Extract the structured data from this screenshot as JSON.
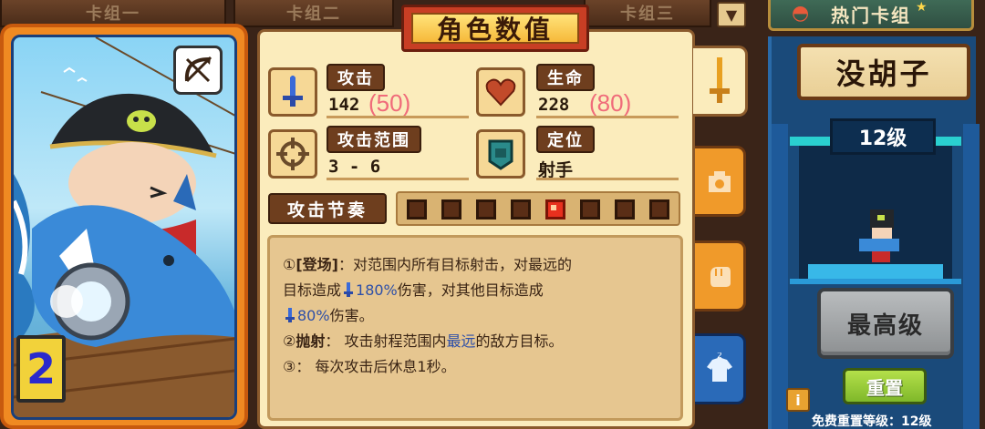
{
  "tabs": [
    {
      "label": "卡组一"
    },
    {
      "label": "卡组二"
    },
    {
      "label": "卡组三"
    }
  ],
  "hot_tab": {
    "label": "热门卡组"
  },
  "title": "角色数值",
  "stats": {
    "attack": {
      "label": "攻击",
      "value": "142",
      "overlay": "(50)"
    },
    "hp": {
      "label": "生命",
      "value": "228",
      "overlay": "(80)"
    },
    "range": {
      "label": "攻击范围",
      "value": "3 - 6"
    },
    "role": {
      "label": "定位",
      "value": "射手"
    }
  },
  "rhythm": {
    "label": "攻击节奏",
    "beats": 8,
    "active_index": 4
  },
  "description": {
    "line1": {
      "prefix": "①",
      "tag": "[登场]",
      "text": "：对范围内所有目标射击，对最远的"
    },
    "line2": {
      "pre": "目标造成",
      "pct": "180%",
      "post": "伤害，对其他目标造成"
    },
    "line3": {
      "pct": "80%",
      "post": "伤害。"
    },
    "line4": {
      "prefix": "②",
      "tag": "抛射",
      "pre": "：  攻击射程范围内",
      "hl": "最远",
      "post": "的敌方目标。"
    },
    "line5": {
      "text": "③：  每次攻击后休息1秒。"
    }
  },
  "card": {
    "rank": "2"
  },
  "hero": {
    "name": "没胡子",
    "level": "12级",
    "max_button": "最高级",
    "reset_button": "重置",
    "info_button": "i",
    "free_reset": "免费重置等级：12级"
  },
  "colors": {
    "accent_red": "#c83e24",
    "panel_bg": "#fbecbc",
    "highlight_blue": "#2d4fa8",
    "overlay_pink": "#f06b7a"
  }
}
